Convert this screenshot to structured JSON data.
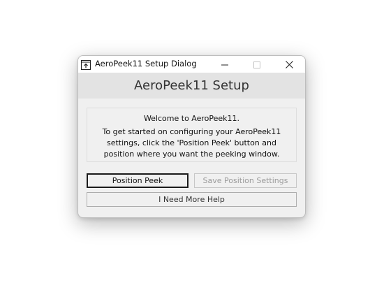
{
  "window": {
    "title": "AeroPeek11 Setup Dialog",
    "icon": "app-window-icon",
    "controls": {
      "minimize_icon": "minimize-icon",
      "maximize_icon": "maximize-icon",
      "close_icon": "close-icon"
    }
  },
  "header": {
    "title": "AeroPeek11 Setup"
  },
  "welcome": {
    "heading": "Welcome to AeroPeek11.",
    "line1": "To get started on configuring your AeroPeek11",
    "line2": "settings, click the 'Position Peek' button and",
    "line3": "position where you want the peeking window."
  },
  "buttons": {
    "position_peek": "Position Peek",
    "save_position": "Save Position Settings",
    "help": "I Need More Help"
  },
  "colors": {
    "window_bg": "#f0f0f0",
    "titlebar_bg": "#ffffff",
    "header_bg": "#e3e3e3",
    "disabled_text": "#9a9a9a"
  }
}
